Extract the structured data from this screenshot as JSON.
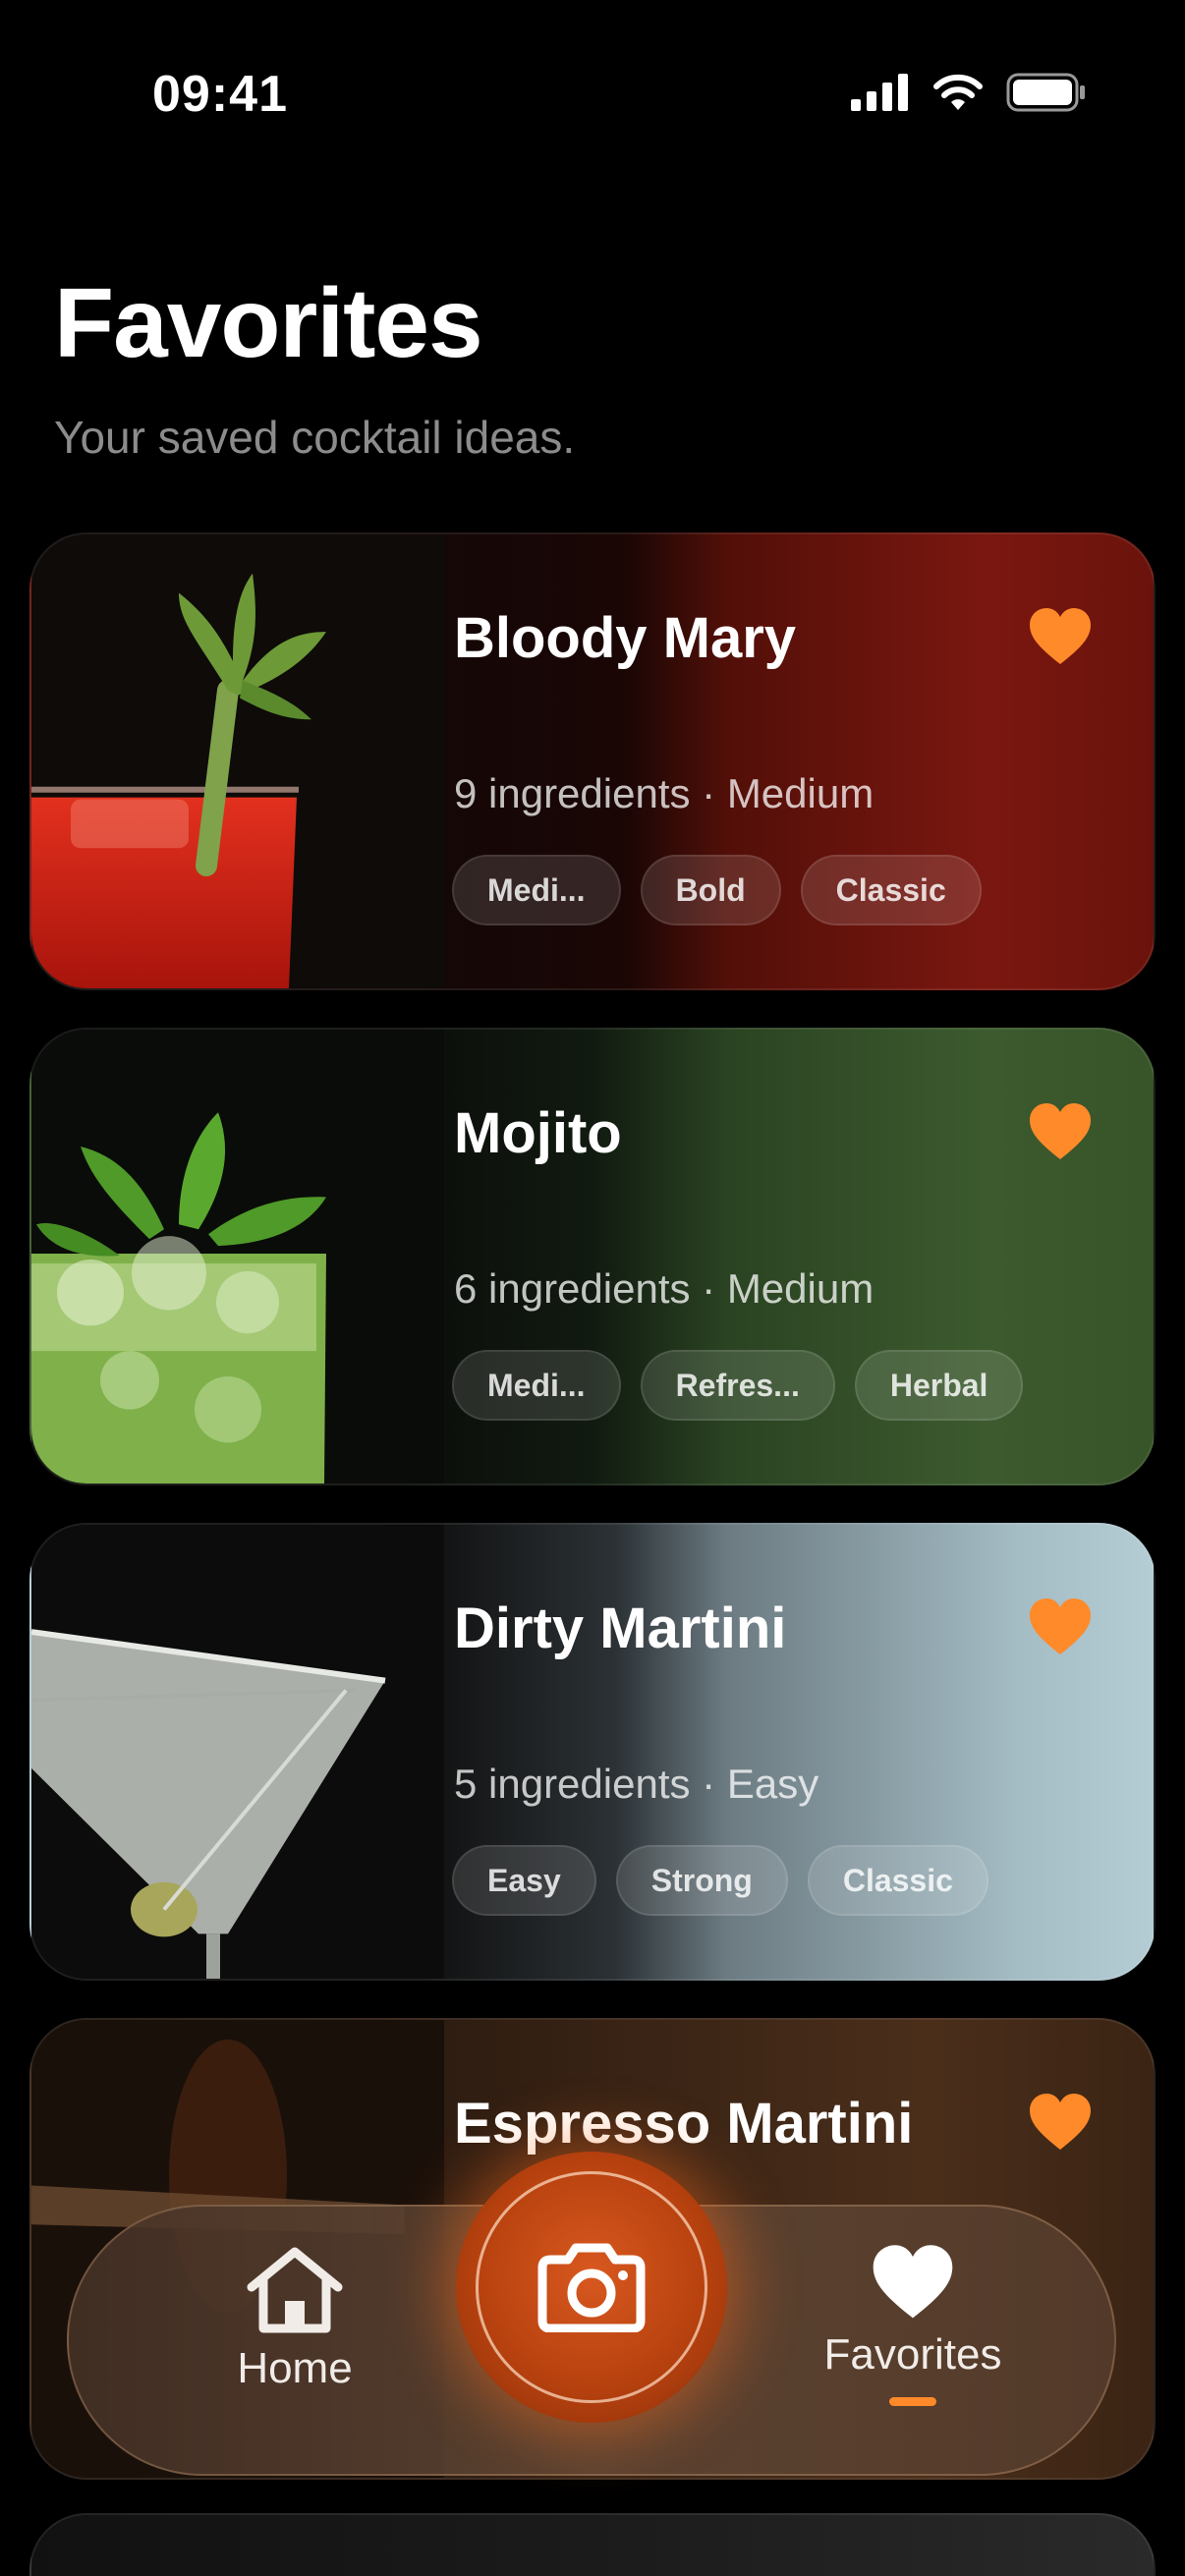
{
  "status_bar": {
    "time": "09:41"
  },
  "header": {
    "title": "Favorites",
    "subtitle": "Your saved cocktail ideas."
  },
  "cards": [
    {
      "name": "Bloody Mary",
      "meta": "9 ingredients · Medium",
      "tags": [
        "Medi...",
        "Bold",
        "Classic"
      ],
      "favorite": true
    },
    {
      "name": "Mojito",
      "meta": "6 ingredients · Medium",
      "tags": [
        "Medi...",
        "Refres...",
        "Herbal"
      ],
      "favorite": true
    },
    {
      "name": "Dirty Martini",
      "meta": "5 ingredients · Easy",
      "tags": [
        "Easy",
        "Strong",
        "Classic"
      ],
      "favorite": true
    },
    {
      "name": "Espresso Martini",
      "favorite": true
    }
  ],
  "tab_bar": {
    "home_label": "Home",
    "favorites_label": "Favorites",
    "active_tab": "favorites"
  },
  "colors": {
    "accent": "#ff8a2a",
    "background": "#000000",
    "subtitle": "#8c8c8c"
  },
  "icons": {
    "signal": "cellular-signal-icon",
    "wifi": "wifi-icon",
    "battery": "battery-icon",
    "favorite": "heart-icon",
    "home": "house-icon",
    "camera": "camera-icon"
  }
}
